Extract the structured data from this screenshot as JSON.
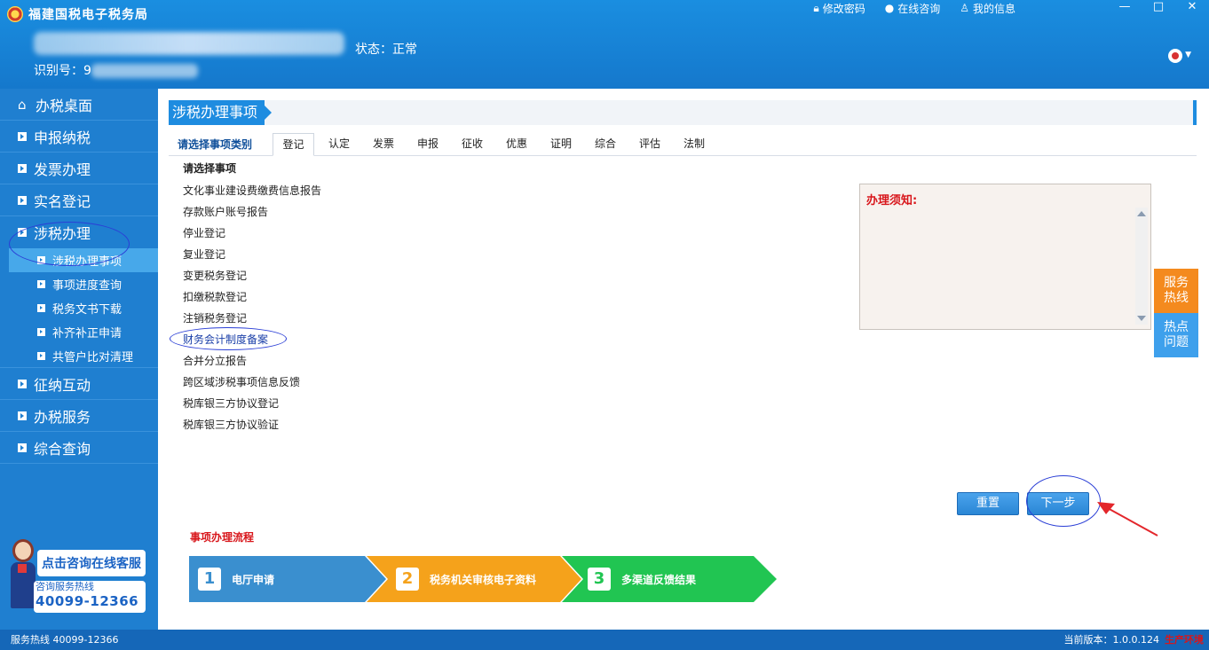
{
  "header": {
    "app_title": "福建国税电子税务局",
    "links": [
      {
        "icon": "lock-icon",
        "label": "修改密码"
      },
      {
        "icon": "chat-icon",
        "label": "在线咨询"
      },
      {
        "icon": "user-icon",
        "label": "我的信息"
      }
    ],
    "status": "状态：正常",
    "taxid_label": "识别号：9"
  },
  "sidebar": {
    "items": [
      {
        "label": "办税桌面",
        "icon": "home-icon"
      },
      {
        "label": "申报纳税"
      },
      {
        "label": "发票办理"
      },
      {
        "label": "实名登记"
      },
      {
        "label": "涉税办理"
      }
    ],
    "subitems": [
      {
        "label": "涉税办理事项",
        "active": true
      },
      {
        "label": "事项进度查询"
      },
      {
        "label": "税务文书下载"
      },
      {
        "label": "补齐补正申请"
      },
      {
        "label": "共管户比对清理"
      }
    ],
    "items_after": [
      {
        "label": "征纳互动"
      },
      {
        "label": "办税服务"
      },
      {
        "label": "综合查询"
      }
    ],
    "help": {
      "chat_label": "点击咨询在线客服",
      "hotline_label": "咨询服务热线",
      "hotline_number": "40099-12366"
    }
  },
  "main": {
    "title": "涉税办理事项",
    "tabs_label": "请选择事项类别",
    "tabs": [
      "登记",
      "认定",
      "发票",
      "申报",
      "征收",
      "优惠",
      "证明",
      "综合",
      "评估",
      "法制"
    ],
    "active_tab": "登记",
    "select_title": "请选择事项",
    "items": [
      "文化事业建设费缴费信息报告",
      "存款账户账号报告",
      "停业登记",
      "复业登记",
      "变更税务登记",
      "扣缴税款登记",
      "注销税务登记",
      "财务会计制度备案",
      "合并分立报告",
      "跨区域涉税事项信息反馈",
      "税库银三方协议登记",
      "税库银三方协议验证"
    ],
    "notice_title": "办理须知:",
    "float_buttons": [
      "服务热线",
      "热点问题"
    ],
    "buttons": {
      "reset": "重置",
      "next": "下一步"
    },
    "flow_title": "事项办理流程",
    "flow_steps": [
      {
        "num": "1",
        "label": "电厅申请",
        "color": "#3a8fcf"
      },
      {
        "num": "2",
        "label": "税务机关审核电子资料",
        "color": "#f5a21b"
      },
      {
        "num": "3",
        "label": "多渠道反馈结果",
        "color": "#21c552"
      }
    ]
  },
  "footer": {
    "hotline": "服务热线 40099-12366",
    "version": "当前版本：1.0.0.124",
    "env": "生产环境"
  }
}
